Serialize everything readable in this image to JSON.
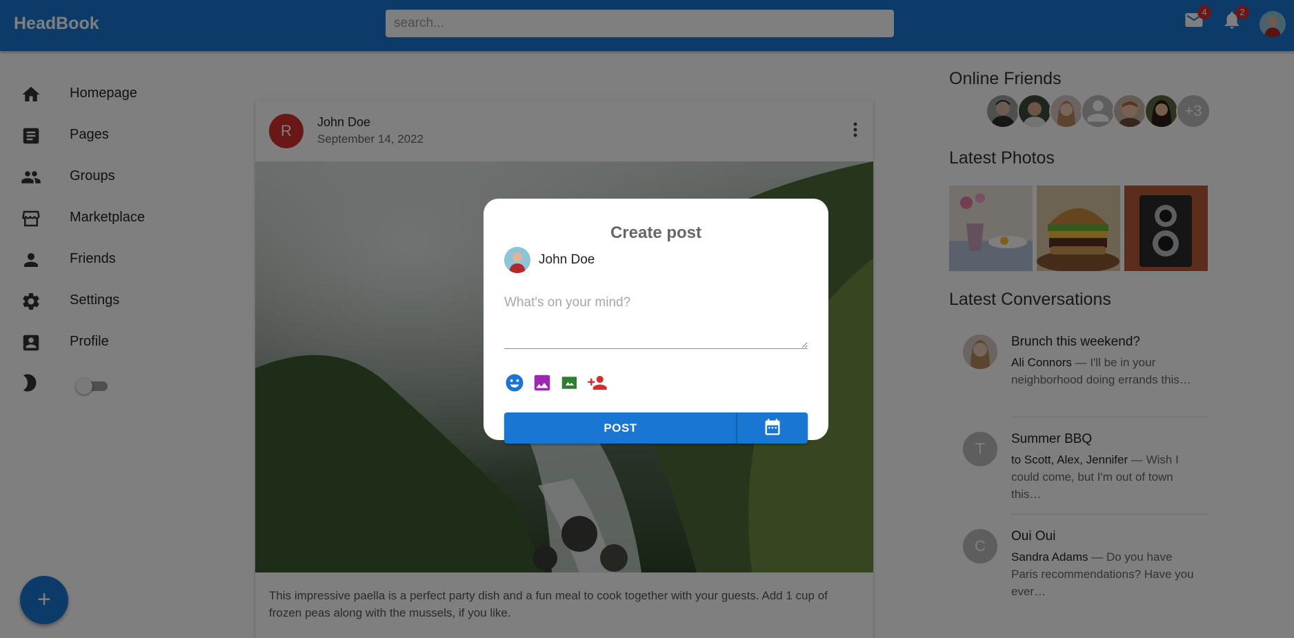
{
  "app": {
    "title": "HeadBook"
  },
  "header": {
    "search_placeholder": "search...",
    "mail_count": "4",
    "notif_count": "2",
    "icons": [
      "mail-icon",
      "bell-icon",
      "avatar"
    ]
  },
  "sidebar": {
    "items": [
      {
        "label": "Homepage",
        "icon": "home-icon"
      },
      {
        "label": "Pages",
        "icon": "article-icon"
      },
      {
        "label": "Groups",
        "icon": "group-icon"
      },
      {
        "label": "Marketplace",
        "icon": "store-icon"
      },
      {
        "label": "Friends",
        "icon": "person-icon"
      },
      {
        "label": "Settings",
        "icon": "gear-icon"
      },
      {
        "label": "Profile",
        "icon": "account-box-icon"
      }
    ],
    "dark_mode": {
      "icon": "moon-icon",
      "enabled": false
    },
    "fab": "+"
  },
  "feed": {
    "post": {
      "avatar_letter": "R",
      "author": "John Doe",
      "date": "September 14, 2022",
      "text": "This impressive paella is a perfect party dish and a fun meal to cook together with your guests. Add 1 cup of frozen peas along with the mussels, if you like."
    }
  },
  "rightbar": {
    "online_title": "Online Friends",
    "online_more": "+3",
    "photos_title": "Latest Photos",
    "conversations_title": "Latest Conversations",
    "conversations": [
      {
        "title": "Brunch this weekend?",
        "from": "Ali Connors",
        "snippet": " — I'll be in your neighborhood doing errands this…",
        "avatar": ""
      },
      {
        "title": "Summer BBQ",
        "from": "to Scott, Alex, Jennifer",
        "snippet": " — Wish I could come, but I'm out of town this…",
        "avatar": "T"
      },
      {
        "title": "Oui Oui",
        "from": "Sandra Adams",
        "snippet": " — Do you have Paris recommendations? Have you ever…",
        "avatar": "C"
      }
    ]
  },
  "modal": {
    "title": "Create post",
    "user": "John Doe",
    "placeholder": "What's on your mind?",
    "tools": [
      "emoji-icon",
      "image-icon",
      "video-icon",
      "tag-person-icon"
    ],
    "post_label": "POST",
    "schedule_icon": "calendar-icon"
  },
  "colors": {
    "primary": "#1976d2",
    "badge": "#d32f2f",
    "emoji": "#1976d2",
    "image": "#9c27b0",
    "video": "#2e7d32",
    "tag": "#d32f2f"
  }
}
